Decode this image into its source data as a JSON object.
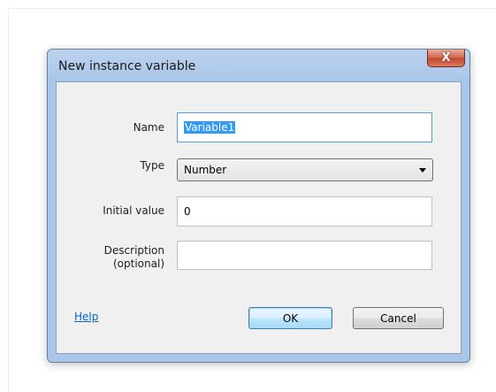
{
  "dialog": {
    "title": "New instance variable",
    "close_glyph": "X"
  },
  "form": {
    "name_label": "Name",
    "name_value": "Variable1",
    "type_label": "Type",
    "type_value": "Number",
    "initial_label": "Initial value",
    "initial_value": "0",
    "description_label_line1": "Description",
    "description_label_line2": "(optional)",
    "description_value": ""
  },
  "footer": {
    "help_label": "Help",
    "ok_label": "OK",
    "cancel_label": "Cancel"
  },
  "icons": {
    "close": "close-icon",
    "dropdown": "chevron-down-icon"
  }
}
